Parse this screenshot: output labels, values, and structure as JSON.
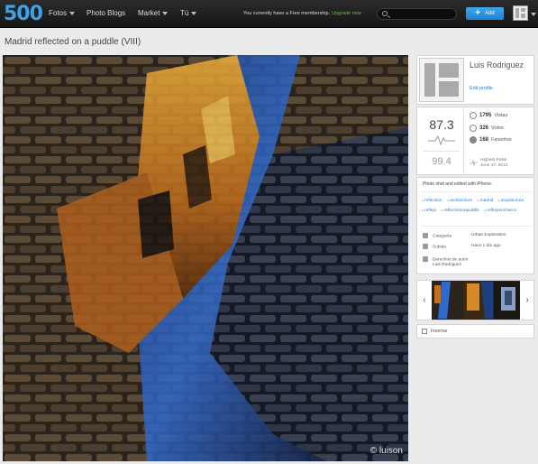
{
  "nav": {
    "logo": "500",
    "items": [
      {
        "label": "Fotos",
        "caret": true
      },
      {
        "label": "Photo Blogs",
        "caret": false
      },
      {
        "label": "Market",
        "caret": true
      },
      {
        "label": "Tú",
        "caret": true
      }
    ],
    "membership_text": "You currently have a Free membership.",
    "upgrade_link": "Upgrade now",
    "search_placeholder": "",
    "add_label": "Add",
    "accent_color": "#3ea2e8"
  },
  "photo": {
    "title": "Madrid reflected on a puddle (VIII)",
    "watermark": "© luison"
  },
  "author": {
    "name": "Luis Rodriguez",
    "edit_profile": "Edit profile"
  },
  "stats": {
    "pulse": "87.3",
    "highest_pulse": "99.4",
    "views_count": "1795",
    "views_label": "Vistas",
    "votes_count": "326",
    "votes_label": "Votos",
    "favorites_count": "168",
    "favorites_label": "Favoritos",
    "highest_label": "Highest Pulse",
    "highest_date": "June 17, 2012"
  },
  "details": {
    "description": "Photo shot and edited with iPhone.",
    "tags": [
      "reflection",
      "architecture",
      "madrid",
      "arquitectura",
      "reflejo",
      "reflectiononpuddle",
      "reflejoencharco"
    ],
    "category_label": "Categoría",
    "category_value": "Urban Exploration",
    "uploaded_label": "Subida",
    "uploaded_value": "Hace 1 día ago",
    "copyright_label": "Derechos de autor",
    "copyright_value": "Luis Rodriguez"
  },
  "embed": {
    "label": "Insertar"
  }
}
